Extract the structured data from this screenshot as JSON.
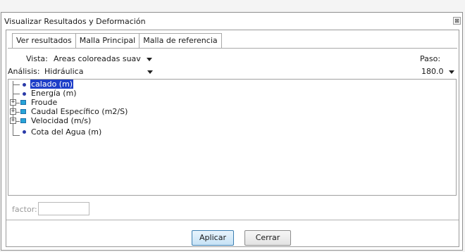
{
  "window": {
    "title": "Visualizar Resultados y Deformación",
    "close_glyph": "⊠"
  },
  "tabs": [
    {
      "label": "Ver resultados",
      "active": true
    },
    {
      "label": "Malla Principal",
      "active": false
    },
    {
      "label": "Malla de referencia",
      "active": false
    }
  ],
  "vista": {
    "label": "Vista:",
    "value": "Areas coloreadas suav"
  },
  "analisis": {
    "label": "Análisis:",
    "value": "Hidráulica"
  },
  "paso": {
    "label": "Paso:",
    "value": "180.0"
  },
  "tree": {
    "items": [
      {
        "label": "calado (m)",
        "icon": "dot-icon",
        "expandable": false,
        "selected": true
      },
      {
        "label": "Energía (m)",
        "icon": "dot-icon",
        "expandable": false,
        "selected": false
      },
      {
        "label": "Froude",
        "icon": "square-icon",
        "expandable": true,
        "selected": false
      },
      {
        "label": "Caudal Específico (m2/S)",
        "icon": "square-icon",
        "expandable": true,
        "selected": false
      },
      {
        "label": "Velocidad (m/s)",
        "icon": "square-icon",
        "expandable": true,
        "selected": false
      },
      {
        "label": "Cota del Agua (m)",
        "icon": "dot-icon",
        "expandable": false,
        "selected": false
      }
    ]
  },
  "factor": {
    "label": "factor:",
    "value": ""
  },
  "buttons": {
    "apply": "Aplicar",
    "close": "Cerrar"
  },
  "colors": {
    "selection": "#1e3ec8",
    "accent": "#28a5d8"
  }
}
